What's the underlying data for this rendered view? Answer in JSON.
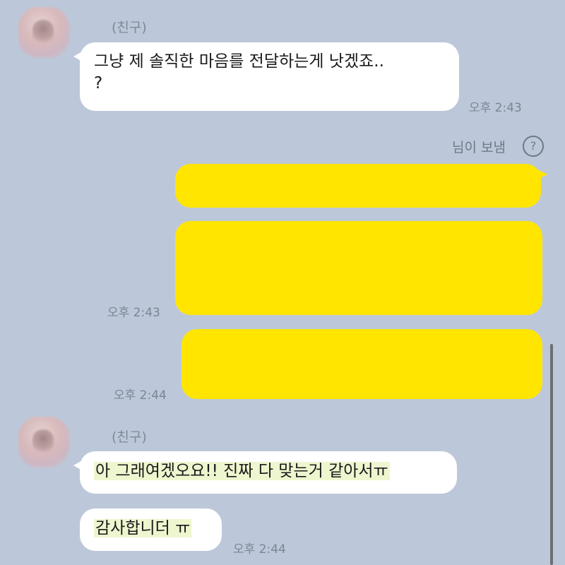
{
  "messages": {
    "friend_name_1": "(친구)",
    "msg1_line1": "그냥 제 솔직한 마음를 전달하는게 낫겠죠..",
    "msg1_line2": "?",
    "time1": "오후 2:43",
    "sent_by": "님이 보냄",
    "help_icon_glyph": "?",
    "time2": "오후 2:43",
    "time3": "오후 2:44",
    "friend_name_2": "(친구)",
    "msg2": "아 그래여겠오요!! 진짜 다 맞는거 같아서ㅠ",
    "msg3": "감사합니더 ㅠ",
    "time4": "오후 2:44"
  },
  "colors": {
    "background": "#bcc8d9",
    "sent_bubble": "#ffe500",
    "received_bubble": "#ffffff",
    "highlight": "#eef6cf"
  }
}
